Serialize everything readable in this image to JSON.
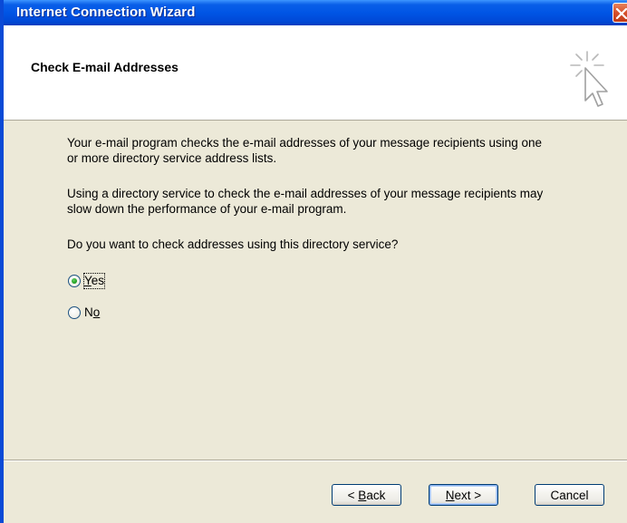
{
  "window": {
    "title": "Internet Connection Wizard"
  },
  "header": {
    "title": "Check E-mail Addresses",
    "icon": "wizard-cursor-sparkle-icon"
  },
  "content": {
    "para1_line1": "Your e-mail program checks the e-mail addresses of your message recipients using one",
    "para1_line2": "or more directory service address lists.",
    "para2_line1": "Using a directory service to check the e-mail addresses of your message recipients may",
    "para2_line2": "slow down the performance of your e-mail program.",
    "question": "Do you want to check addresses using this directory service?"
  },
  "options": {
    "yes": {
      "mnemonic": "Y",
      "rest": "es",
      "checked": true
    },
    "no": {
      "first": "N",
      "mnemonic": "o",
      "checked": false
    }
  },
  "buttons": {
    "back": {
      "prefix": "< ",
      "mnemonic": "B",
      "rest": "ack"
    },
    "next": {
      "mnemonic": "N",
      "rest": "ext >"
    },
    "cancel": {
      "label": "Cancel"
    }
  },
  "colors": {
    "titlebar": "#0055E5",
    "dialog_bg": "#ECE9D8",
    "header_bg": "#FFFFFF",
    "radio_checked": "#21A121",
    "close_button": "#D5502C"
  }
}
